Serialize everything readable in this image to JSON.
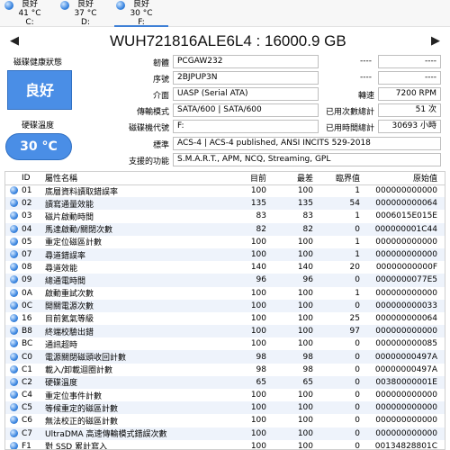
{
  "disks": [
    {
      "status": "良好",
      "temp": "41 °C",
      "letter": "C:"
    },
    {
      "status": "良好",
      "temp": "37 °C",
      "letter": "D:"
    },
    {
      "status": "良好",
      "temp": "30 °C",
      "letter": "F:"
    }
  ],
  "title": "WUH721816ALE6L4 : 16000.9 GB",
  "health": {
    "label": "磁碟健康狀態",
    "status": "良好"
  },
  "temperature": {
    "label": "硬碟溫度",
    "value": "30 °C"
  },
  "info": {
    "firmware_label": "韌體",
    "firmware": "PCGAW232",
    "serial_label": "序號",
    "serial": "2BJPUP3N",
    "interface_label": "介面",
    "interface": "UASP (Serial ATA)",
    "transfer_label": "傳輸模式",
    "transfer": "SATA/600 | SATA/600",
    "drive_letter_label": "磁碟機代號",
    "drive_letter": "F:",
    "standard_label": "標準",
    "standard": "ACS-4 | ACS-4 published, ANSI INCITS 529-2018",
    "features_label": "支援的功能",
    "features": "S.M.A.R.T., APM, NCQ, Streaming, GPL",
    "right_blank_1a": "----",
    "right_blank_1b": "----",
    "right_blank_2a": "----",
    "right_blank_2b": "----",
    "rpm_label": "轉速",
    "rpm": "7200 RPM",
    "power_count_label": "已用次數總計",
    "power_count": "51 次",
    "power_hours_label": "已用時間總計",
    "power_hours": "30693 小時"
  },
  "smart_headers": [
    "ID",
    "屬性名稱",
    "目前",
    "最差",
    "臨界值",
    "原始值"
  ],
  "smart_rows": [
    [
      "01",
      "底層資料讀取錯誤率",
      "100",
      "100",
      "1",
      "000000000000"
    ],
    [
      "02",
      "讀寫通量效能",
      "135",
      "135",
      "54",
      "000000000064"
    ],
    [
      "03",
      "磁片啟動時間",
      "83",
      "83",
      "1",
      "0006015E015E"
    ],
    [
      "04",
      "馬達啟動/關閉次數",
      "82",
      "82",
      "0",
      "000000001C44"
    ],
    [
      "05",
      "重定位磁區計數",
      "100",
      "100",
      "1",
      "000000000000"
    ],
    [
      "07",
      "尋道錯誤率",
      "100",
      "100",
      "1",
      "000000000000"
    ],
    [
      "08",
      "尋道效能",
      "140",
      "140",
      "20",
      "00000000000F"
    ],
    [
      "09",
      "總通電時間",
      "96",
      "96",
      "0",
      "0000000077E5"
    ],
    [
      "0A",
      "啟動重試次數",
      "100",
      "100",
      "1",
      "000000000000"
    ],
    [
      "0C",
      "開關電源次數",
      "100",
      "100",
      "0",
      "000000000033"
    ],
    [
      "16",
      "目前氦氣等級",
      "100",
      "100",
      "25",
      "000000000064"
    ],
    [
      "B8",
      "終端校驗出錯",
      "100",
      "100",
      "97",
      "000000000000"
    ],
    [
      "BC",
      "通訊超時",
      "100",
      "100",
      "0",
      "000000000085"
    ],
    [
      "C0",
      "電源關閉磁頭收回計數",
      "98",
      "98",
      "0",
      "00000000497A"
    ],
    [
      "C1",
      "載入/卸載迴圈計數",
      "98",
      "98",
      "0",
      "00000000497A"
    ],
    [
      "C2",
      "硬碟溫度",
      "65",
      "65",
      "0",
      "00380000001E"
    ],
    [
      "C4",
      "重定位事件計數",
      "100",
      "100",
      "0",
      "000000000000"
    ],
    [
      "C5",
      "等候重定的磁區計數",
      "100",
      "100",
      "0",
      "000000000000"
    ],
    [
      "C6",
      "無法校正的磁區計數",
      "100",
      "100",
      "0",
      "000000000000"
    ],
    [
      "C7",
      "UltraDMA 高速傳輸模式錯誤次數",
      "100",
      "100",
      "0",
      "000000000000"
    ],
    [
      "F1",
      "對 SSD 累計寫入",
      "100",
      "100",
      "0",
      "00134828801C"
    ]
  ]
}
